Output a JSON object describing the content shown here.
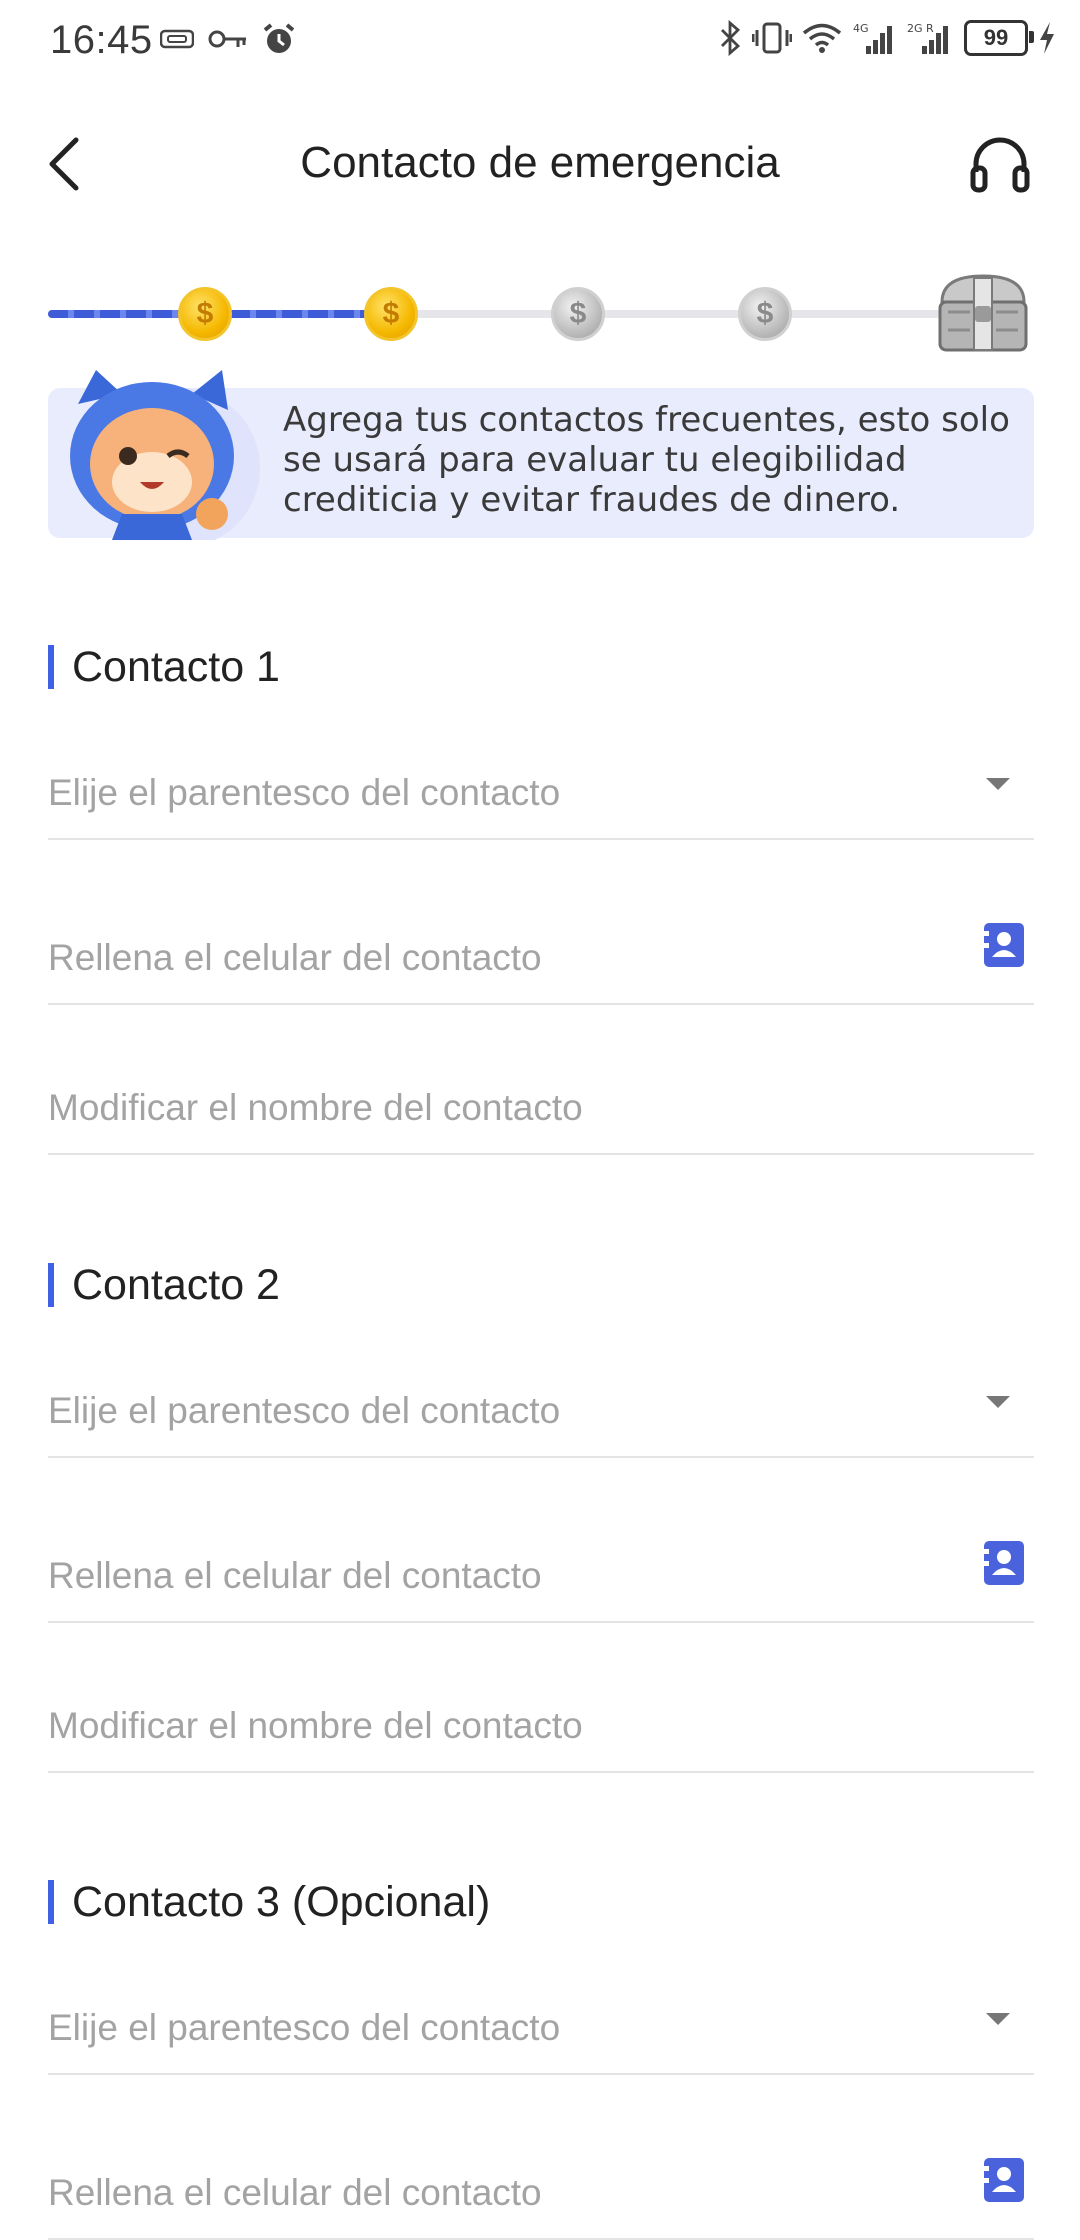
{
  "status_bar": {
    "time": "16:45",
    "battery": "99"
  },
  "header": {
    "title": "Contacto de emergencia"
  },
  "banner": {
    "text": "Agrega tus contactos frecuentes, esto solo se usará para evaluar tu elegibilidad crediticia y evitar fraudes de dinero."
  },
  "progress": {
    "steps_total": 4,
    "steps_completed": 2,
    "coin_symbol": "$"
  },
  "sections": [
    {
      "title": "Contacto 1",
      "relationship_placeholder": "Elije el parentesco del contacto",
      "phone_placeholder": "Rellena el celular del contacto",
      "name_placeholder": "Modificar el nombre del contacto"
    },
    {
      "title": "Contacto 2",
      "relationship_placeholder": "Elije el parentesco del contacto",
      "phone_placeholder": "Rellena el celular del contacto",
      "name_placeholder": "Modificar el nombre del contacto"
    },
    {
      "title": "Contacto 3 (Opcional)",
      "relationship_placeholder": "Elije el parentesco del contacto",
      "phone_placeholder": "Rellena el celular del contacto"
    }
  ],
  "colors": {
    "accent": "#4060e6",
    "banner_bg": "#e9ecfd",
    "placeholder": "#a3a3a3",
    "divider": "#e4e4e4"
  },
  "icons": [
    "back-arrow-icon",
    "headset-icon",
    "coin-icon",
    "treasure-chest-icon",
    "mascot-icon",
    "chevron-down-icon",
    "contacts-book-icon"
  ]
}
